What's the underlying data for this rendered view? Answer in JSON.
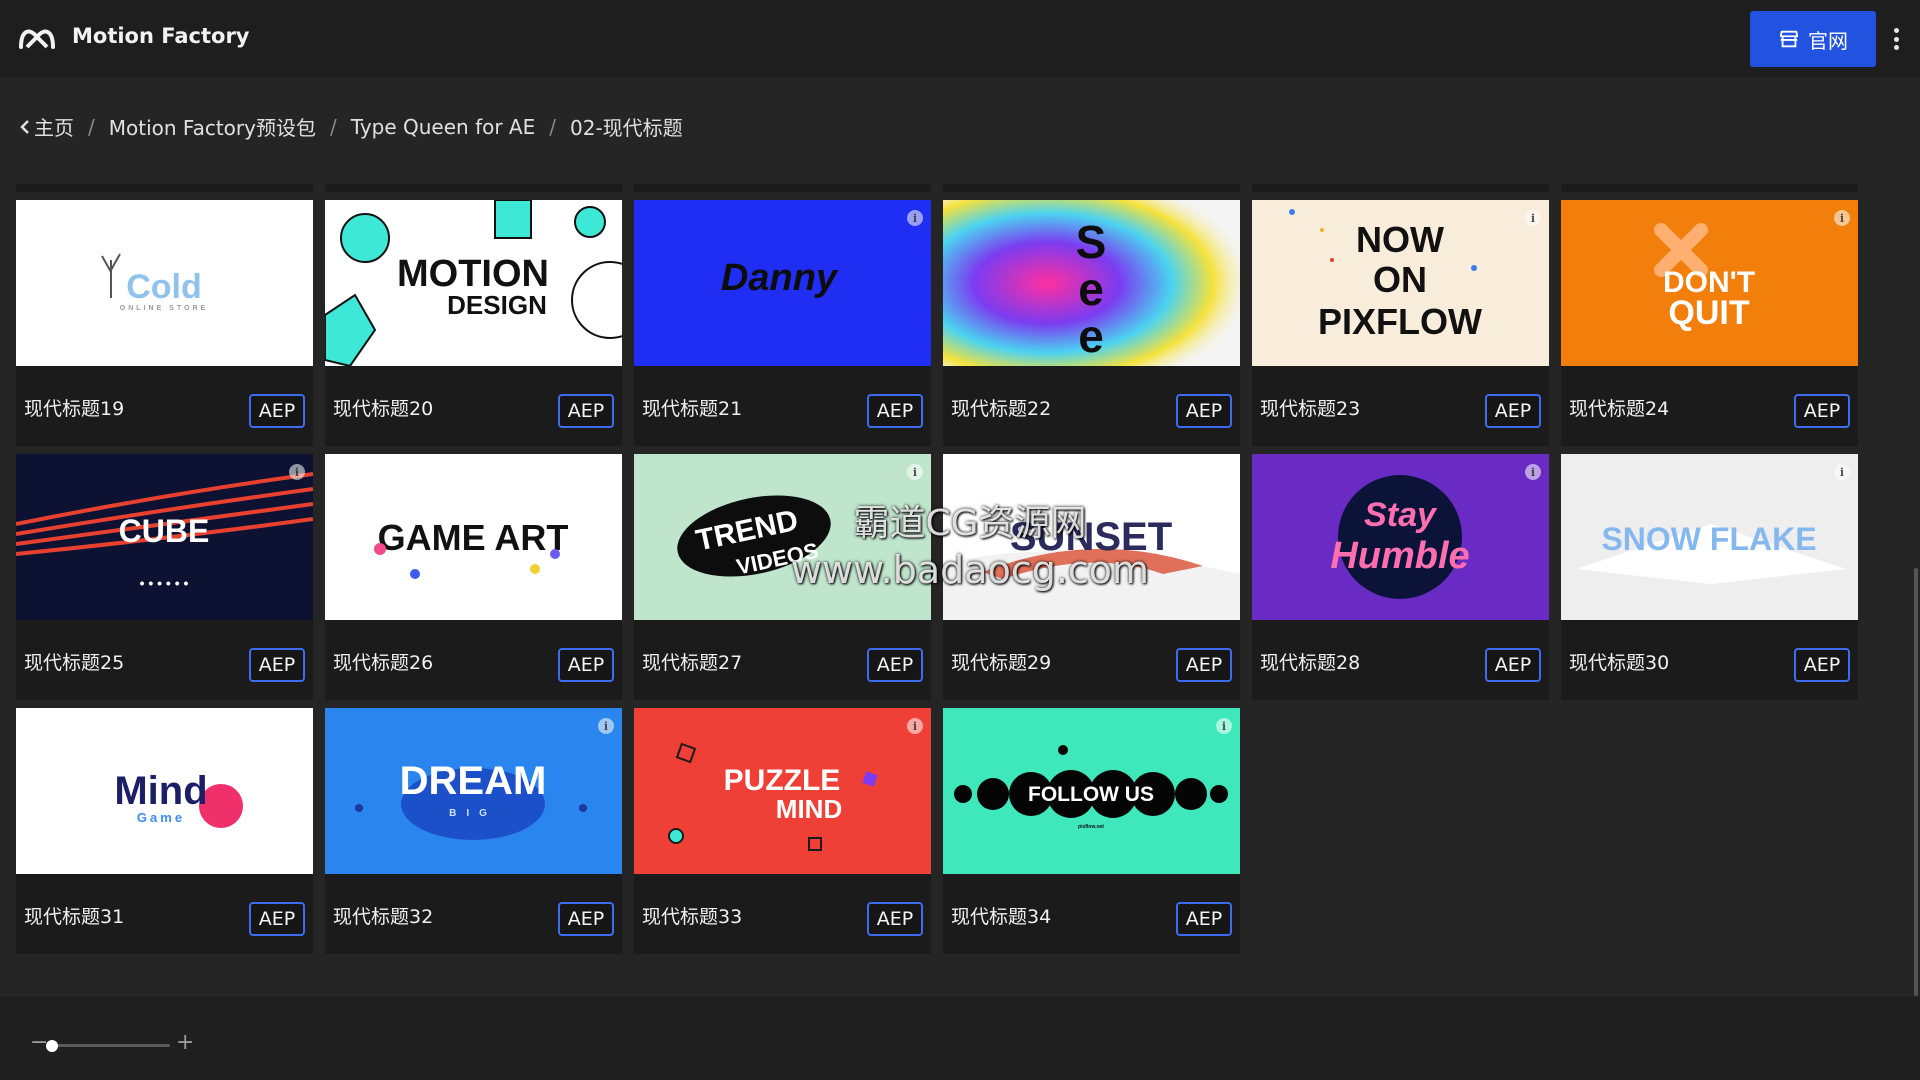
{
  "app": {
    "title": "Motion Factory",
    "site_button_label": "官网"
  },
  "breadcrumb": [
    {
      "label": "主页"
    },
    {
      "label": "Motion Factory预设包"
    },
    {
      "label": "Type Queen for AE"
    },
    {
      "label": "02-现代标题"
    }
  ],
  "badge_label": "AEP",
  "cards": [
    {
      "title": "现代标题19",
      "thumb_text": "Cold",
      "thumb_sub": "ONLINE STORE",
      "bg": "#ffffff",
      "fg": "#8fc2ec",
      "info": false
    },
    {
      "title": "现代标题20",
      "thumb_text": "MOTION",
      "thumb_sub": "DESIGN",
      "bg": "#ffffff",
      "fg": "#111111",
      "info": false
    },
    {
      "title": "现代标题21",
      "thumb_text": "Danny",
      "thumb_sub": "",
      "bg": "#1f2ef2",
      "fg": "#0d0d0d",
      "info": true
    },
    {
      "title": "现代标题22",
      "thumb_text": "See",
      "thumb_sub": "",
      "bg": "#f4f4f4",
      "fg": "#0d0d0d",
      "info": false
    },
    {
      "title": "现代标题23",
      "thumb_text": "NOW ON PIXFLOW",
      "thumb_sub": "",
      "bg": "#f8ecdb",
      "fg": "#111111",
      "info": true
    },
    {
      "title": "现代标题24",
      "thumb_text": "DON'T QUIT",
      "thumb_sub": "",
      "bg": "#f27e0c",
      "fg": "#ffffff",
      "info": true
    },
    {
      "title": "现代标题25",
      "thumb_text": "CUBE",
      "thumb_sub": "",
      "bg": "#0d1233",
      "fg": "#ffffff",
      "info": true
    },
    {
      "title": "现代标题26",
      "thumb_text": "GAME ART",
      "thumb_sub": "",
      "bg": "#ffffff",
      "fg": "#111111",
      "info": false
    },
    {
      "title": "现代标题27",
      "thumb_text": "TREND VIDEOS",
      "thumb_sub": "",
      "bg": "#bfe6cc",
      "fg": "#ffffff",
      "info": true
    },
    {
      "title": "现代标题29",
      "thumb_text": "SUNSET",
      "thumb_sub": "",
      "bg": "#ffffff",
      "fg": "#2b2b5e",
      "info": false
    },
    {
      "title": "现代标题28",
      "thumb_text": "Stay Humble",
      "thumb_sub": "",
      "bg": "#6a2bc4",
      "fg": "#ff6fb0",
      "info": true
    },
    {
      "title": "现代标题30",
      "thumb_text": "SNOW FLAKE",
      "thumb_sub": "",
      "bg": "#eeeeee",
      "fg": "#86b8f0",
      "info": true
    },
    {
      "title": "现代标题31",
      "thumb_text": "Mind",
      "thumb_sub": "Game",
      "bg": "#ffffff",
      "fg": "#1c1f66",
      "info": false
    },
    {
      "title": "现代标题32",
      "thumb_text": "DREAM",
      "thumb_sub": "BIG",
      "bg": "#2a86ee",
      "fg": "#ffffff",
      "info": true
    },
    {
      "title": "现代标题33",
      "thumb_text": "PUZZLE",
      "thumb_sub": "MIND",
      "bg": "#ee4037",
      "fg": "#ffffff",
      "info": true
    },
    {
      "title": "现代标题34",
      "thumb_text": "FOLLOW US",
      "thumb_sub": "",
      "bg": "#3ee8bb",
      "fg": "#ffffff",
      "info": true
    }
  ],
  "watermark": {
    "line1": "霸道CG资源网",
    "line2": "www.badaocg.com"
  },
  "zoom": {
    "minus": "−",
    "plus": "+",
    "level": 0.0
  }
}
